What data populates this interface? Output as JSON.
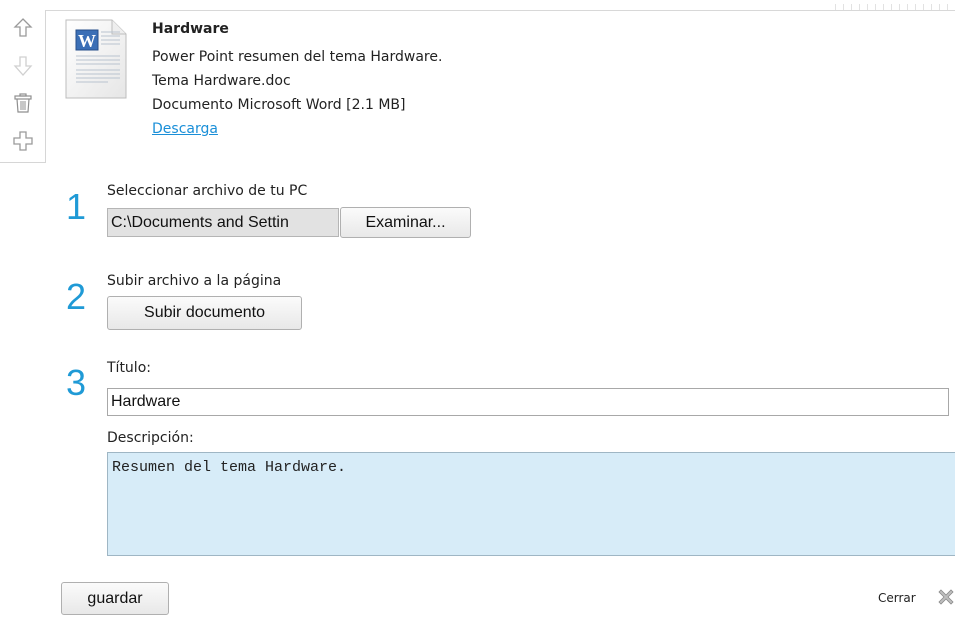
{
  "document": {
    "title": "Hardware",
    "summary": "Power Point resumen del tema Hardware.",
    "filename": "Tema Hardware.doc",
    "filetype": "Documento Microsoft Word [2.1 MB]",
    "download_label": "Descarga",
    "icon": "word-doc-icon"
  },
  "tools": [
    "arrow-up-icon",
    "arrow-down-icon",
    "trash-icon",
    "add-icon"
  ],
  "steps": {
    "step1": {
      "number": "1",
      "label": "Seleccionar archivo de tu PC",
      "file_value": "C:\\Documents and Settin",
      "browse_label": "Examinar..."
    },
    "step2": {
      "number": "2",
      "label": "Subir archivo a la página",
      "upload_label": "Subir documento"
    },
    "step3": {
      "number": "3",
      "title_label": "Título:",
      "title_value": "Hardware",
      "desc_label": "Descripción:",
      "desc_value": "Resumen del tema Hardware."
    }
  },
  "footer": {
    "save_label": "guardar",
    "close_label": "Cerrar"
  },
  "colors": {
    "accent": "#1f9ad6",
    "link": "#1a8fd8",
    "desc_bg": "#d7ecf8"
  }
}
